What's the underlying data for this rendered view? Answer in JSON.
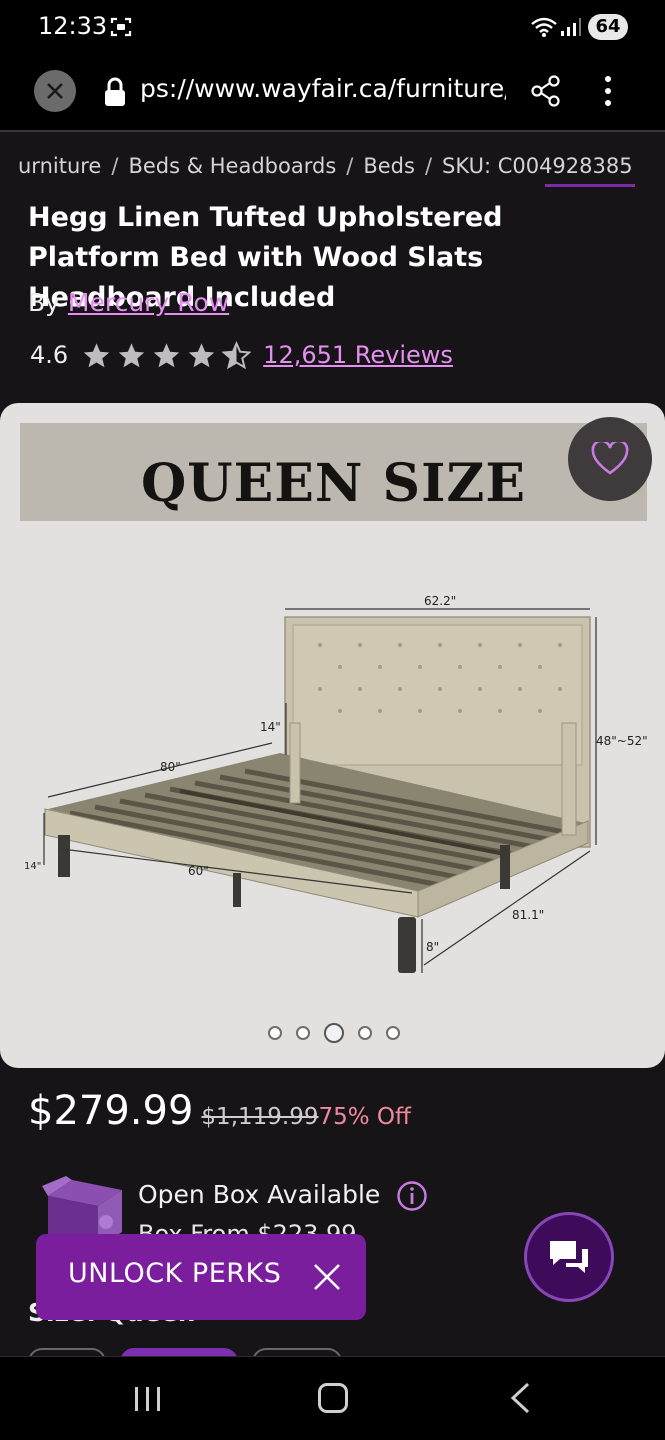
{
  "status_bar": {
    "time": "12:33",
    "battery": "64"
  },
  "browser": {
    "url": "ps://www.wayfair.ca/furniture/"
  },
  "breadcrumb": {
    "items": [
      "urniture",
      "Beds & Headboards",
      "Beds",
      "SKU: C004928385"
    ],
    "separator": "/"
  },
  "product": {
    "title": "Hegg Linen Tufted Upholstered Platform Bed with Wood Slats Headboard Included",
    "by_prefix": "By",
    "brand": "Mercury Row",
    "rating": "4.6",
    "rating_value": 4.6,
    "rating_max": 5,
    "reviews": "12,651 Reviews"
  },
  "image": {
    "banner": "QUEEN SIZE",
    "dimensions": {
      "headboard_width": "62.2\"",
      "headboard_height": "48\"~52\"",
      "headboard_leg": "14\"",
      "length": "80\"",
      "width": "60\"",
      "side_height": "14\"",
      "overall_length": "81.1\"",
      "clearance": "8\""
    },
    "carousel_total": 5,
    "carousel_active": 3
  },
  "price": {
    "current": "$279.99",
    "original": "$1,119.99",
    "discount": "75% Off"
  },
  "open_box": {
    "label": "Open Box Available",
    "price_partial": "Box From $223.99"
  },
  "size": {
    "label": "Size: Queen"
  },
  "promo": {
    "label": "UNLOCK PERKS"
  },
  "colors": {
    "accent": "#7a1e9e",
    "link": "#e58ff0",
    "discount": "#f08aa0"
  }
}
